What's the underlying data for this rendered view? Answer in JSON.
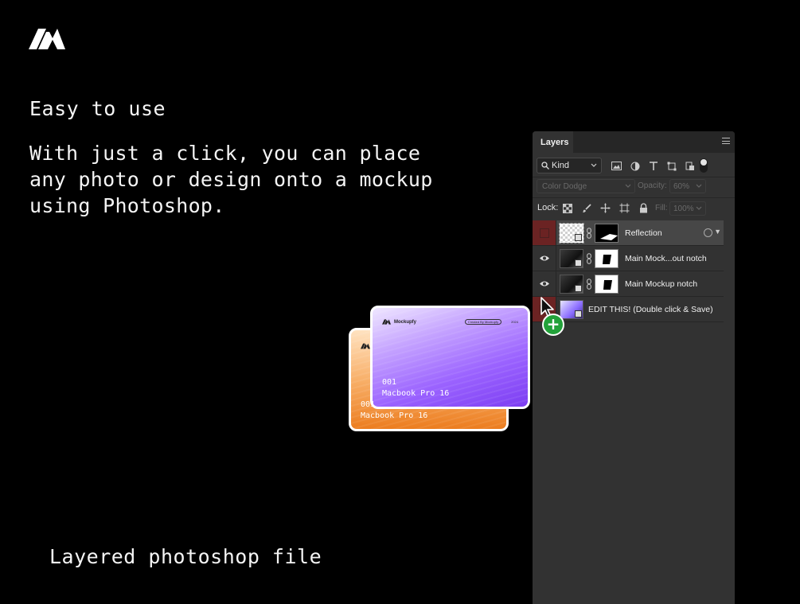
{
  "headline": "Easy to use",
  "body": "With just a click, you can place any photo or design onto a mockup using Photoshop.",
  "footer": "Layered photoshop file",
  "cards": {
    "brand": "Mockupfy",
    "pill": "Created By Mockupfy",
    "year": "2024",
    "number": "001",
    "model": "Macbook Pro 16",
    "back_number": "001",
    "back_model": "Macbook Pro 16"
  },
  "layers_panel": {
    "tab": "Layers",
    "kind_label": "Kind",
    "blend_mode": "Color Dodge",
    "opacity_label": "Opacity:",
    "opacity_value": "60%",
    "lock_label": "Lock:",
    "fill_label": "Fill:",
    "fill_value": "100%",
    "layers": [
      {
        "name": "Reflection",
        "visible": false
      },
      {
        "name": "Main Mock...out notch",
        "visible": true
      },
      {
        "name": "Main Mockup notch",
        "visible": true
      },
      {
        "name": "EDIT THIS! (Double click & Save)",
        "visible": false
      }
    ]
  },
  "colors": {
    "background": "#000000",
    "panel": "#323232",
    "card_front_accent": "#8b4dff",
    "card_back_accent": "#f0852a",
    "add_badge": "#23a23a"
  },
  "add_badge_symbol": "+"
}
